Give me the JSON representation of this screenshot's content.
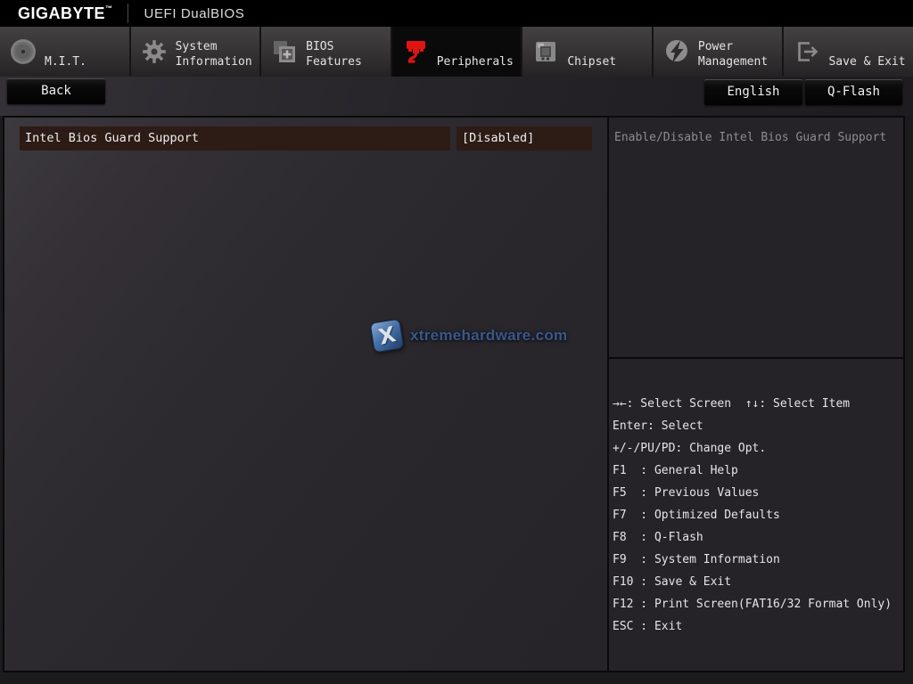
{
  "header": {
    "brand": "GIGABYTE",
    "brand_tm": "™",
    "title": "UEFI DualBIOS"
  },
  "tabs": [
    {
      "label": "M.I.T.",
      "icon": "mit-icon",
      "active": false
    },
    {
      "label": "System Information",
      "icon": "gear-icon",
      "active": false
    },
    {
      "label": "BIOS Features",
      "icon": "bios-chip-icon",
      "active": false
    },
    {
      "label": "Peripherals",
      "icon": "peripherals-icon",
      "active": true
    },
    {
      "label": "Chipset",
      "icon": "chipset-icon",
      "active": false
    },
    {
      "label": "Power Management",
      "icon": "power-bolt-icon",
      "active": false
    },
    {
      "label": "Save & Exit",
      "icon": "exit-door-icon",
      "active": false
    }
  ],
  "toolbar": {
    "back_label": "Back",
    "language_label": "English",
    "qflash_label": "Q-Flash"
  },
  "settings": [
    {
      "name": "Intel Bios Guard Support",
      "value": "[Disabled]",
      "selected": true
    }
  ],
  "help": {
    "text": "Enable/Disable Intel Bios Guard Support"
  },
  "shortcuts": {
    "lines": [
      "→←: Select Screen  ↑↓: Select Item",
      "Enter: Select",
      "+/-/PU/PD: Change Opt.",
      "F1  : General Help",
      "F5  : Previous Values",
      "F7  : Optimized Defaults",
      "F8  : Q-Flash",
      "F9  : System Information",
      "F10 : Save & Exit",
      "F12 : Print Screen(FAT16/32 Format Only)",
      "ESC : Exit"
    ]
  },
  "watermark": {
    "icon_letter": "X",
    "text": "xtremehardware.com"
  },
  "colors": {
    "accent_red": "#e01410",
    "highlight_row": "#2d1b15",
    "tab_active_bg": "#0a0a0a",
    "help_text": "#8e8c8d"
  }
}
